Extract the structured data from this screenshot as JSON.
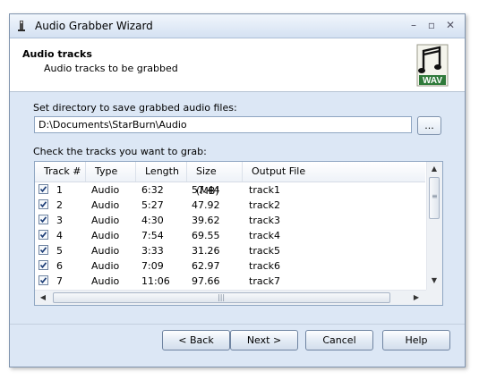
{
  "window": {
    "title": "Audio Grabber Wizard",
    "controls": [
      "minimize",
      "maximize",
      "close"
    ]
  },
  "header": {
    "title": "Audio tracks",
    "subtitle": "Audio tracks to be grabbed",
    "icon": "wav-file-icon",
    "icon_label": "WAV"
  },
  "directory": {
    "label": "Set directory to save grabbed audio files:",
    "value": "D:\\Documents\\StarBurn\\Audio",
    "browse_label": "..."
  },
  "tracks": {
    "label": "Check the tracks you want to grab:",
    "columns": [
      "Track #",
      "Type",
      "Length",
      "Size (MB)",
      "Output File"
    ],
    "rows": [
      {
        "checked": true,
        "track": "1",
        "type": "Audio",
        "length": "6:32",
        "size": "57.44",
        "file": "track1"
      },
      {
        "checked": true,
        "track": "2",
        "type": "Audio",
        "length": "5:27",
        "size": "47.92",
        "file": "track2"
      },
      {
        "checked": true,
        "track": "3",
        "type": "Audio",
        "length": "4:30",
        "size": "39.62",
        "file": "track3"
      },
      {
        "checked": true,
        "track": "4",
        "type": "Audio",
        "length": "7:54",
        "size": "69.55",
        "file": "track4"
      },
      {
        "checked": true,
        "track": "5",
        "type": "Audio",
        "length": "3:33",
        "size": "31.26",
        "file": "track5"
      },
      {
        "checked": true,
        "track": "6",
        "type": "Audio",
        "length": "7:09",
        "size": "62.97",
        "file": "track6"
      },
      {
        "checked": true,
        "track": "7",
        "type": "Audio",
        "length": "11:06",
        "size": "97.66",
        "file": "track7"
      }
    ]
  },
  "buttons": {
    "back": "< Back",
    "next": "Next >",
    "cancel": "Cancel",
    "help": "Help"
  }
}
